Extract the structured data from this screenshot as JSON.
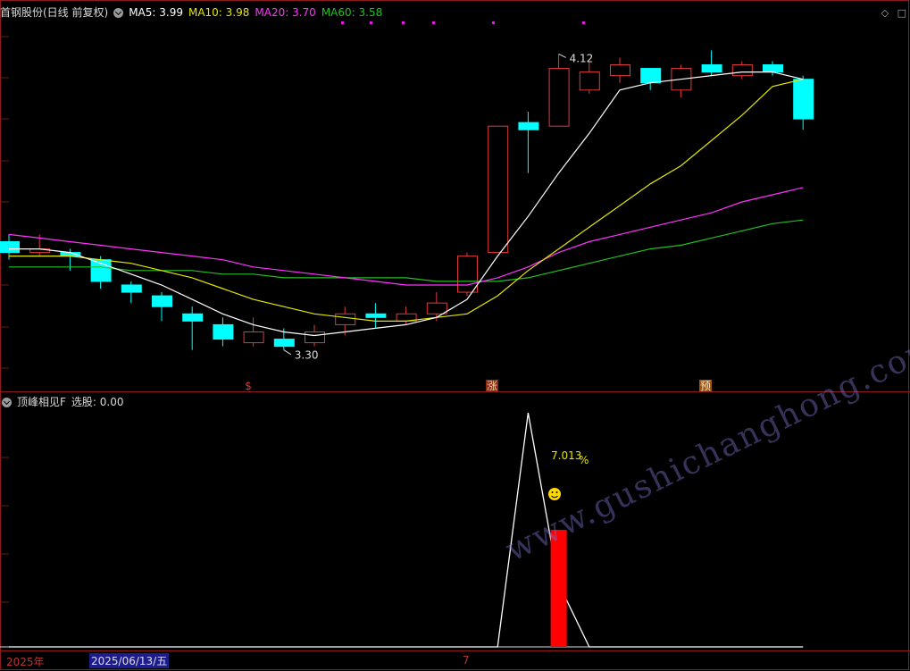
{
  "header": {
    "title": "首钢股份(日线 前复权)",
    "ma5": "MA5: 3.99",
    "ma10": "MA10: 3.98",
    "ma20": "MA20: 3.70",
    "ma60": "MA60: 3.58"
  },
  "indicator": {
    "title": "顶峰相见F",
    "xuangu": "选股: 0.00",
    "percent_label": "7.013",
    "percent_sign": "%",
    "smiley": "☺"
  },
  "markers": {
    "s": "$",
    "zhang": "涨",
    "yu": "预"
  },
  "price_labels": {
    "high": "4.12",
    "low": "3.30"
  },
  "footer": {
    "year": "2025年",
    "date": "2025/06/13/五",
    "tick": "7"
  },
  "watermark": "www.gushichanghong.com",
  "colors": {
    "up": "#e03a3a",
    "down": "#00ffff",
    "ma5": "#ffffff",
    "ma10": "#e6e600",
    "ma20": "#ff33ff",
    "ma60": "#22c022",
    "separator": "#8c1c1c",
    "grid": "#6a1a1a"
  },
  "chart_data": {
    "type": "candlestick",
    "candles": [
      {
        "o": 3.6,
        "c": 3.57,
        "h": 3.62,
        "l": 3.55
      },
      {
        "o": 3.57,
        "c": 3.58,
        "h": 3.62,
        "l": 3.56
      },
      {
        "o": 3.57,
        "c": 3.56,
        "h": 3.58,
        "l": 3.52
      },
      {
        "o": 3.55,
        "c": 3.49,
        "h": 3.56,
        "l": 3.47
      },
      {
        "o": 3.48,
        "c": 3.46,
        "h": 3.49,
        "l": 3.43
      },
      {
        "o": 3.45,
        "c": 3.42,
        "h": 3.46,
        "l": 3.38
      },
      {
        "o": 3.4,
        "c": 3.38,
        "h": 3.42,
        "l": 3.3
      },
      {
        "o": 3.37,
        "c": 3.33,
        "h": 3.39,
        "l": 3.31
      },
      {
        "o": 3.32,
        "c": 3.35,
        "h": 3.39,
        "l": 3.31
      },
      {
        "o": 3.33,
        "c": 3.31,
        "h": 3.36,
        "l": 3.3
      },
      {
        "o": 3.32,
        "c": 3.35,
        "h": 3.37,
        "l": 3.31
      },
      {
        "o": 3.37,
        "c": 3.4,
        "h": 3.42,
        "l": 3.34
      },
      {
        "o": 3.4,
        "c": 3.39,
        "h": 3.43,
        "l": 3.36
      },
      {
        "o": 3.38,
        "c": 3.4,
        "h": 3.42,
        "l": 3.37
      },
      {
        "o": 3.4,
        "c": 3.43,
        "h": 3.46,
        "l": 3.38
      },
      {
        "o": 3.46,
        "c": 3.56,
        "h": 3.57,
        "l": 3.45
      },
      {
        "o": 3.57,
        "c": 3.92,
        "h": 3.92,
        "l": 3.57
      },
      {
        "o": 3.93,
        "c": 3.91,
        "h": 3.96,
        "l": 3.79
      },
      {
        "o": 3.92,
        "c": 4.08,
        "h": 4.12,
        "l": 3.92
      },
      {
        "o": 4.02,
        "c": 4.07,
        "h": 4.1,
        "l": 4.01
      },
      {
        "o": 4.06,
        "c": 4.09,
        "h": 4.11,
        "l": 4.04
      },
      {
        "o": 4.08,
        "c": 4.04,
        "h": 4.08,
        "l": 4.02
      },
      {
        "o": 4.02,
        "c": 4.08,
        "h": 4.09,
        "l": 4.0
      },
      {
        "o": 4.09,
        "c": 4.07,
        "h": 4.13,
        "l": 4.06
      },
      {
        "o": 4.06,
        "c": 4.09,
        "h": 4.1,
        "l": 4.05
      },
      {
        "o": 4.09,
        "c": 4.07,
        "h": 4.1,
        "l": 4.06
      },
      {
        "o": 4.05,
        "c": 3.94,
        "h": 4.06,
        "l": 3.91
      }
    ],
    "ma5": [
      3.58,
      3.58,
      3.57,
      3.54,
      3.51,
      3.48,
      3.44,
      3.4,
      3.37,
      3.35,
      3.34,
      3.35,
      3.36,
      3.37,
      3.39,
      3.44,
      3.56,
      3.67,
      3.79,
      3.9,
      4.02,
      4.04,
      4.05,
      4.06,
      4.07,
      4.07,
      4.05
    ],
    "ma10": [
      3.56,
      3.56,
      3.56,
      3.55,
      3.54,
      3.52,
      3.5,
      3.47,
      3.44,
      3.42,
      3.4,
      3.39,
      3.38,
      3.38,
      3.39,
      3.4,
      3.45,
      3.52,
      3.58,
      3.64,
      3.7,
      3.76,
      3.81,
      3.88,
      3.95,
      4.03,
      4.05
    ],
    "ma20": [
      3.62,
      3.61,
      3.6,
      3.59,
      3.58,
      3.57,
      3.56,
      3.55,
      3.53,
      3.52,
      3.51,
      3.5,
      3.49,
      3.48,
      3.48,
      3.48,
      3.5,
      3.53,
      3.57,
      3.6,
      3.62,
      3.64,
      3.66,
      3.68,
      3.71,
      3.73,
      3.75
    ],
    "ma60": [
      3.53,
      3.53,
      3.53,
      3.53,
      3.52,
      3.52,
      3.52,
      3.51,
      3.51,
      3.5,
      3.5,
      3.5,
      3.5,
      3.5,
      3.49,
      3.49,
      3.49,
      3.5,
      3.52,
      3.54,
      3.56,
      3.58,
      3.59,
      3.61,
      3.63,
      3.65,
      3.66
    ],
    "price_range": [
      3.22,
      4.22
    ],
    "indicator": {
      "line": [
        0,
        0,
        0,
        0,
        0,
        0,
        0,
        0,
        0,
        0,
        0,
        0,
        0,
        0,
        0,
        0,
        0,
        10,
        2.7,
        0,
        0,
        0,
        0,
        0,
        0,
        0,
        0
      ],
      "bar_index": 18,
      "bar_value": 5.0,
      "range": [
        0,
        10
      ]
    }
  }
}
